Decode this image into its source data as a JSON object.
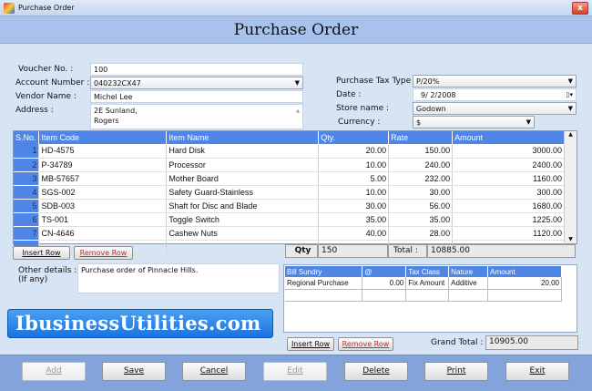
{
  "window": {
    "title": "Purchase Order",
    "close": "x"
  },
  "header": {
    "title": "Purchase Order"
  },
  "form": {
    "voucher_label": "Voucher No. :",
    "voucher": "100",
    "account_label": "Account Number :",
    "account": "040232CX47",
    "vendor_label": "Vendor Name :",
    "vendor": "Michel Lee",
    "address_label": "Address :",
    "address_line1": "2E Sunland,",
    "address_line2": "Rogers",
    "tax_label": "Purchase Tax Type",
    "tax": "P/20%",
    "date_label": "Date :",
    "date": "9/ 2/2008",
    "store_label": "Store name :",
    "store": "Godown",
    "currency_label": "Currency :",
    "currency": "$"
  },
  "items": {
    "columns": [
      "S.No.",
      "Item Code",
      "Item Name",
      "Qty.",
      "Rate",
      "Amount"
    ],
    "rows": [
      [
        "1",
        "HD-4575",
        "Hard Disk",
        "20.00",
        "150.00",
        "3000.00"
      ],
      [
        "2",
        "P-34789",
        "Processor",
        "10.00",
        "240.00",
        "2400.00"
      ],
      [
        "3",
        "MB-57657",
        "Mother Board",
        "5.00",
        "232.00",
        "1160.00"
      ],
      [
        "4",
        "SGS-002",
        "Safety Guard-Stainless",
        "10.00",
        "30.00",
        "300.00"
      ],
      [
        "5",
        "SDB-003",
        "Shaft for Disc and Blade",
        "30.00",
        "56.00",
        "1680.00"
      ],
      [
        "6",
        "TS-001",
        "Toggle Switch",
        "35.00",
        "35.00",
        "1225.00"
      ],
      [
        "7",
        "CN-4646",
        "Cashew Nuts",
        "40.00",
        "28.00",
        "1120.00"
      ]
    ],
    "insert_row": "Insert Row",
    "remove_row": "Remove Row",
    "qty_label": "Qty",
    "qty": "150",
    "total_label": "Total :",
    "total": "10885.00"
  },
  "other": {
    "label1": "Other details :",
    "label2": "(If any)",
    "value": "Purchase order of Pinnacle Hills."
  },
  "logo": "IbusinessUtilities.com",
  "sundry": {
    "columns": [
      "Bill Sundry",
      "@",
      "Tax Class",
      "Nature",
      "Amount"
    ],
    "row": [
      "Regional Purchase",
      "0.00",
      "Fix Amount",
      "Additive",
      "20.00"
    ],
    "insert_row": "Insert Row",
    "remove_row": "Remove Row",
    "grand_total_label": "Grand Total :",
    "grand_total": "10905.00"
  },
  "buttons": {
    "add": "Add",
    "save": "Save",
    "cancel": "Cancel",
    "edit": "Edit",
    "delete": "Delete",
    "print": "Print",
    "exit": "Exit"
  }
}
